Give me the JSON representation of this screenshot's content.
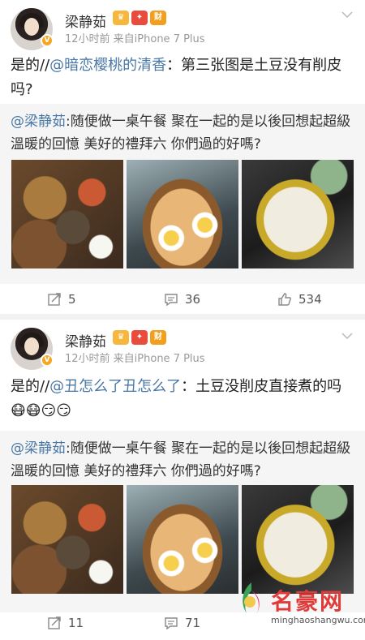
{
  "posts": [
    {
      "username": "梁静茹",
      "badges": [
        "♛",
        "✦",
        "财"
      ],
      "meta": "12小时前  来自iPhone 7 Plus",
      "text_prefix": "是的//",
      "text_mention": "@暗恋樱桃的清香",
      "text_suffix": "：第三张图是土豆没有削皮吗?",
      "repost_mention": "@梁静茹",
      "repost_text": ":随便做一桌午餐 聚在一起的是以後回想起超級溫暖的回憶 美好的禮拜六 你們過的好嗎?",
      "actions": {
        "repost": "5",
        "comment": "36",
        "like": "534"
      }
    },
    {
      "username": "梁静茹",
      "badges": [
        "♛",
        "✦",
        "财"
      ],
      "meta": "12小时前  来自iPhone 7 Plus",
      "text_prefix": "是的//",
      "text_mention": "@丑怎么了丑怎么了",
      "text_suffix": "：土豆没削皮直接煮的吗😷😷😏😏",
      "repost_mention": "@梁静茹",
      "repost_text": ":随便做一桌午餐 聚在一起的是以後回想起超級溫暖的回憶 美好的禮拜六 你們過的好嗎?",
      "actions": {
        "repost": "11",
        "comment": "71"
      }
    }
  ],
  "watermark": {
    "title": "名豪网",
    "subtitle": "minghaoshangwu.com"
  },
  "colors": {
    "link": "#4a78a6",
    "badge_orange": "#f5a623"
  }
}
